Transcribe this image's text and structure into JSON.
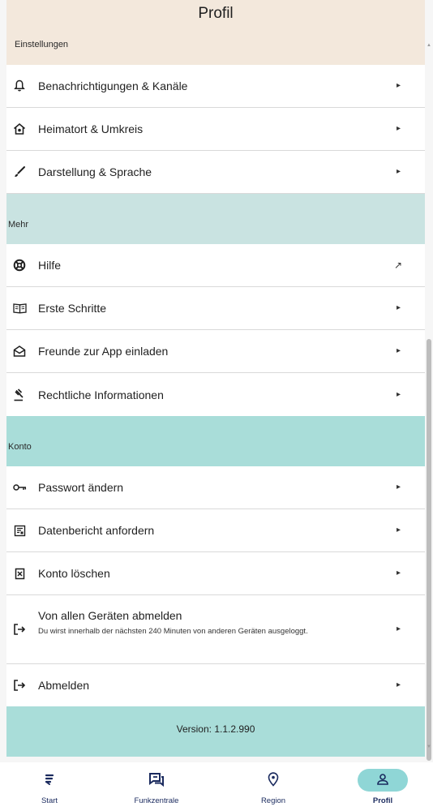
{
  "header": {
    "title": "Profil"
  },
  "sections": {
    "einstellungen": "Einstellungen",
    "mehr": "Mehr",
    "konto": "Konto"
  },
  "settings_items": [
    {
      "label": "Benachrichtigungen & Kanäle",
      "icon": "bell-icon",
      "chevron": "▸"
    },
    {
      "label": "Heimatort & Umkreis",
      "icon": "home-icon",
      "chevron": "▸"
    },
    {
      "label": "Darstellung & Sprache",
      "icon": "brush-icon",
      "chevron": "▸"
    }
  ],
  "more_items": [
    {
      "label": "Hilfe",
      "icon": "lifebuoy-icon",
      "chevron": "↗"
    },
    {
      "label": "Erste Schritte",
      "icon": "book-icon",
      "chevron": "▸"
    },
    {
      "label": "Freunde zur App einladen",
      "icon": "envelope-icon",
      "chevron": "▸"
    },
    {
      "label": "Rechtliche Informationen",
      "icon": "gavel-icon",
      "chevron": "▸"
    }
  ],
  "account_items": [
    {
      "label": "Passwort ändern",
      "icon": "key-icon",
      "chevron": "▸"
    },
    {
      "label": "Datenbericht anfordern",
      "icon": "report-icon",
      "chevron": "▸"
    },
    {
      "label": "Konto löschen",
      "icon": "delete-account-icon",
      "chevron": "▸"
    },
    {
      "label": "Von allen Geräten abmelden",
      "sub": "Du wirst innerhalb der nächsten 240 Minuten von anderen Geräten ausgeloggt.",
      "icon": "logout-icon",
      "chevron": "▸"
    },
    {
      "label": "Abmelden",
      "icon": "logout-icon",
      "chevron": "▸"
    }
  ],
  "version": "Version: 1.1.2.990",
  "nav": [
    {
      "label": "Start",
      "icon": "start-icon",
      "active": false
    },
    {
      "label": "Funkzentrale",
      "icon": "chat-icon",
      "active": false
    },
    {
      "label": "Region",
      "icon": "location-pin-icon",
      "active": false
    },
    {
      "label": "Profil",
      "icon": "person-icon",
      "active": true
    }
  ],
  "colors": {
    "header_bg": "#f3e8dc",
    "mehr_bg": "#c9e3e1",
    "konto_bg": "#a9ddd9",
    "active_pill": "#8fd6d6",
    "nav_text": "#1a2a5e"
  }
}
